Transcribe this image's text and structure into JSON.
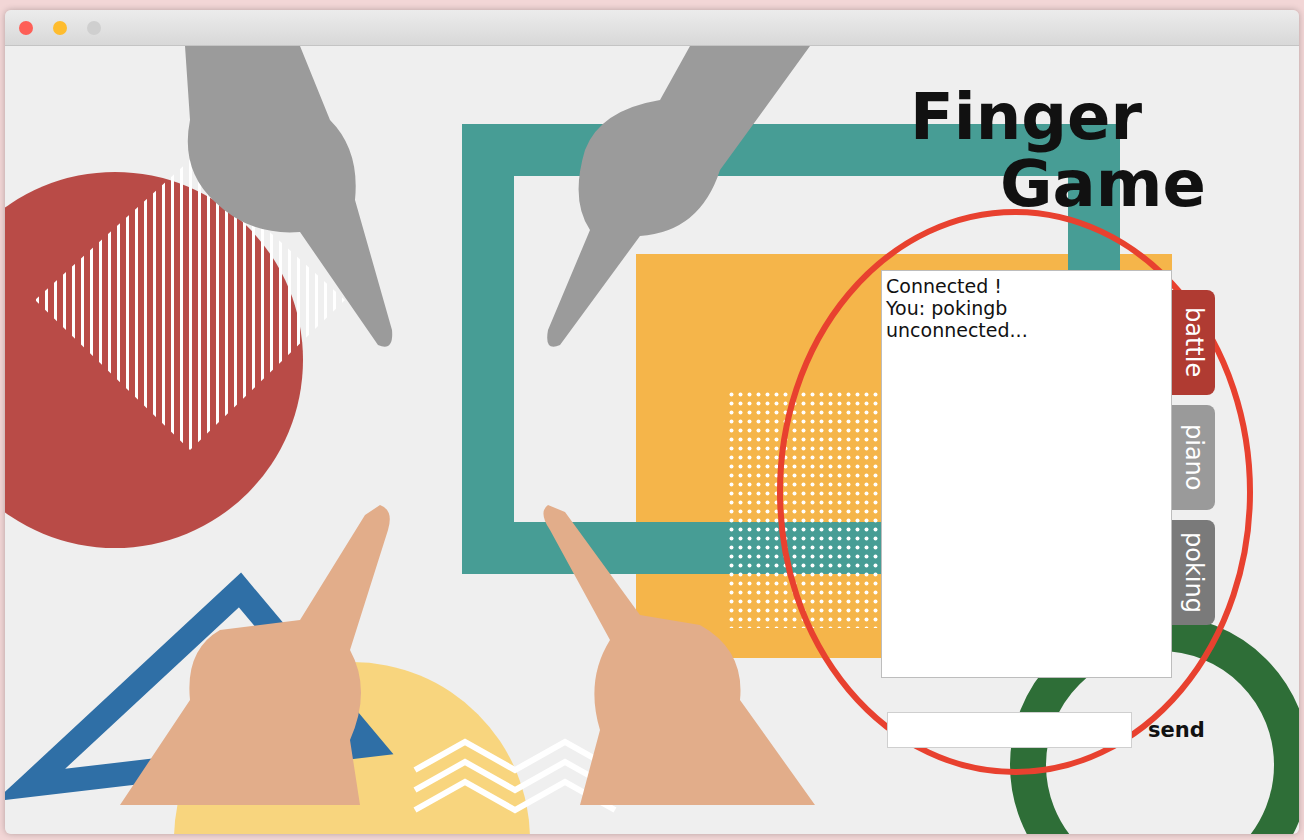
{
  "title": {
    "lines": [
      "Finger",
      "Game"
    ]
  },
  "chat": {
    "messages": [
      "Connected !",
      "You: pokingb",
      "unconnected..."
    ]
  },
  "modes": [
    {
      "label": "battle",
      "color": "#b03b32"
    },
    {
      "label": "piano",
      "color": "#9a9a9a"
    },
    {
      "label": "poking",
      "color": "#7a7a7a"
    }
  ],
  "input": {
    "value": ""
  },
  "send_button": {
    "label": "send"
  }
}
